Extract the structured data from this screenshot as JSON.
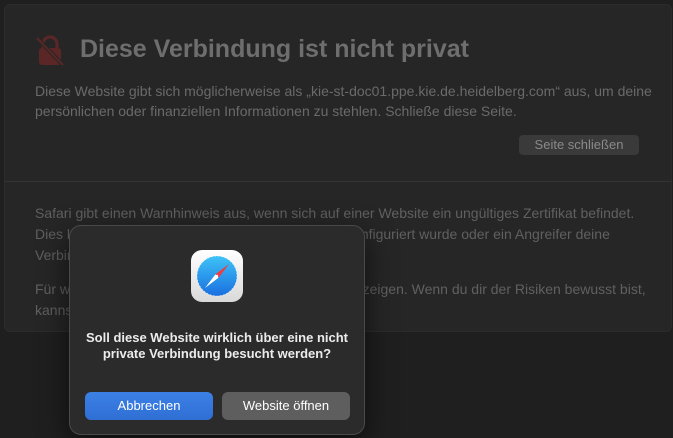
{
  "warning": {
    "title": "Diese Verbindung ist nicht privat",
    "description": "Diese Website gibt sich möglicherweise als „kie-st-doc01.ppe.kie.de.heidelberg.com“ aus, um deine persönlichen oder finanziellen Informationen zu stehlen. Schließe diese Seite.",
    "close_button": "Seite schließen",
    "info_line1": "Safari gibt einen Warnhinweis aus, wenn sich auf einer Website ein ungültiges Zertifikat befindet. Dies kann passieren, wenn die Website fehlerhaft konfiguriert wurde oder ein Angreifer deine Verbindung kompromittiert hat.",
    "info_line2": "Für weitere Informationen kannst du das Zertifikat anzeigen. Wenn du dir der Risiken bewusst bist, kannst du die Website besuchen."
  },
  "dialog": {
    "message": "Soll diese Website wirklich über eine nicht private Verbindung besucht werden?",
    "cancel_button": "Abbrechen",
    "open_button": "Website öffnen"
  },
  "icons": {
    "lock": "broken-lock-icon",
    "safari": "safari-compass-icon"
  },
  "colors": {
    "lock_red": "#5a2626",
    "accent_blue": "#3478e0",
    "secondary_button": "#5e5e5e"
  }
}
